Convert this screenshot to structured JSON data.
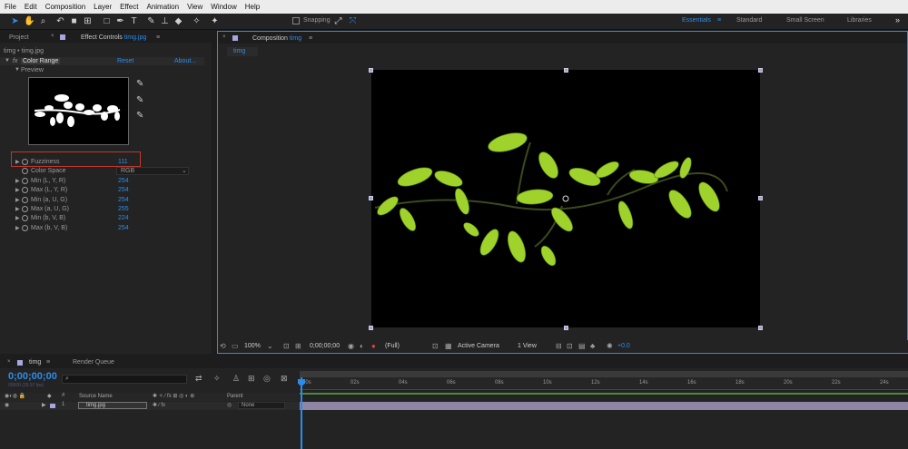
{
  "menu": [
    "File",
    "Edit",
    "Composition",
    "Layer",
    "Effect",
    "Animation",
    "View",
    "Window",
    "Help"
  ],
  "toolbar": {
    "snapping_label": "Snapping",
    "workspaces": [
      "Essentials",
      "Standard",
      "Small Screen",
      "Libraries"
    ],
    "active_workspace": "Essentials",
    "more": "»"
  },
  "left": {
    "tab_project": "Project",
    "tab_effect_controls": "Effect Controls",
    "effect_controls_layer": "timg.jpg",
    "breadcrumb": "timg • timg.jpg",
    "fx_label": "fx",
    "effect_name": "Color Range",
    "reset": "Reset",
    "about": "About...",
    "preview_label": "Preview",
    "properties": [
      {
        "name": "Fuzziness",
        "value": "111",
        "stopwatch": true,
        "expand": true,
        "highlighted": true
      },
      {
        "name": "Color Space",
        "value": "RGB",
        "stopwatch": true,
        "expand": false,
        "dropdown": true
      },
      {
        "name": "Min (L, Y, R)",
        "value": "254",
        "stopwatch": true,
        "expand": true
      },
      {
        "name": "Max (L, Y, R)",
        "value": "254",
        "stopwatch": true,
        "expand": true
      },
      {
        "name": "Min (a, U, G)",
        "value": "254",
        "stopwatch": true,
        "expand": true
      },
      {
        "name": "Max (a, U, G)",
        "value": "255",
        "stopwatch": true,
        "expand": true
      },
      {
        "name": "Min (b, V, B)",
        "value": "224",
        "stopwatch": true,
        "expand": true
      },
      {
        "name": "Max (b, V, B)",
        "value": "254",
        "stopwatch": true,
        "expand": true
      }
    ]
  },
  "comp": {
    "tab_label": "Composition",
    "comp_name": "timg",
    "subtab": "timg",
    "zoom": "100%",
    "timecode": "0;00;00;00",
    "resolution": "(Full)",
    "camera": "Active Camera",
    "view": "1 View",
    "exposure": "+0.0"
  },
  "timeline": {
    "tab": "timg",
    "render_queue": "Render Queue",
    "timecode": "0;00;00;00",
    "fps_info": "00000 (29.97 fps)",
    "search_placeholder": "",
    "col_source": "Source Name",
    "col_parent": "Parent",
    "layer_num": "1",
    "layer_name": "timg.jpg",
    "parent_value": "None",
    "ruler": [
      "00s",
      "02s",
      "04s",
      "06s",
      "08s",
      "10s",
      "12s",
      "14s",
      "16s",
      "18s",
      "20s",
      "22s",
      "24s"
    ]
  },
  "colors": {
    "accent": "#2d8ceb",
    "highlight_box": "#c0392b",
    "leaf": "#9fd22a",
    "track": "#8f86a6"
  }
}
